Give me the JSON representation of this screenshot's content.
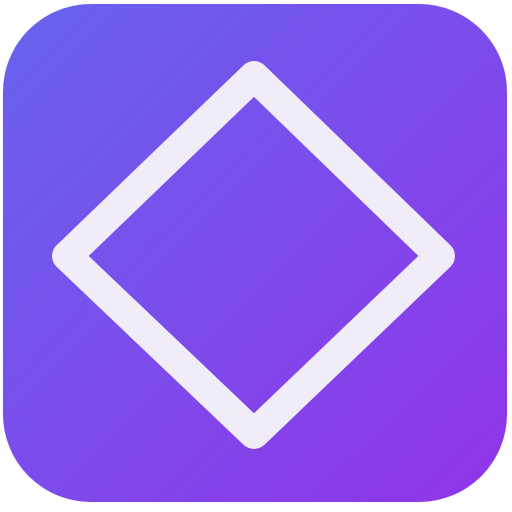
{
  "icon": {
    "glyph": "diamond-outline-icon",
    "colors": {
      "gradient_start": "#6763EE",
      "gradient_end": "#9134E8",
      "stroke": "#F0ECF8"
    }
  }
}
